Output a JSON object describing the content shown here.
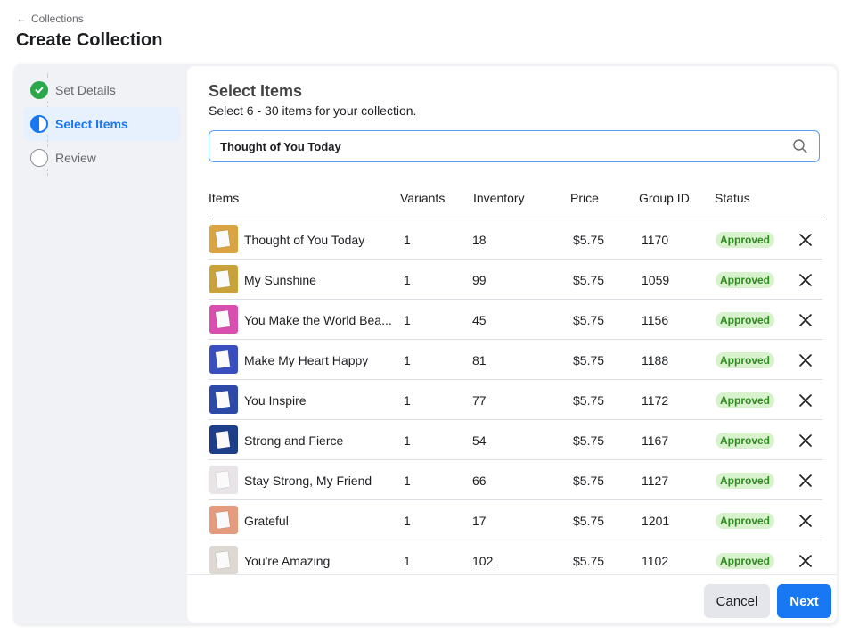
{
  "header": {
    "back_label": "Collections",
    "title": "Create Collection"
  },
  "steps": [
    {
      "label": "Set Details",
      "state": "done"
    },
    {
      "label": "Select Items",
      "state": "active"
    },
    {
      "label": "Review",
      "state": "todo"
    }
  ],
  "panel": {
    "title": "Select Items",
    "subtitle": "Select 6 - 30 items for your collection.",
    "search_value": "Thought of You Today"
  },
  "table": {
    "columns": [
      "Items",
      "Variants",
      "Inventory",
      "Price",
      "Group ID",
      "Status"
    ],
    "rows": [
      {
        "name": "Thought of You Today",
        "variants": "1",
        "inventory": "18",
        "price": "$5.75",
        "group_id": "1170",
        "status": "Approved",
        "thumb": "#d9a441"
      },
      {
        "name": "My Sunshine",
        "variants": "1",
        "inventory": "99",
        "price": "$5.75",
        "group_id": "1059",
        "status": "Approved",
        "thumb": "#c9a23a"
      },
      {
        "name": "You Make the World Bea...",
        "variants": "1",
        "inventory": "45",
        "price": "$5.75",
        "group_id": "1156",
        "status": "Approved",
        "thumb": "#d94fb0"
      },
      {
        "name": "Make My Heart Happy",
        "variants": "1",
        "inventory": "81",
        "price": "$5.75",
        "group_id": "1188",
        "status": "Approved",
        "thumb": "#3a4fbf"
      },
      {
        "name": "You Inspire",
        "variants": "1",
        "inventory": "77",
        "price": "$5.75",
        "group_id": "1172",
        "status": "Approved",
        "thumb": "#2d4aa8"
      },
      {
        "name": "Strong and Fierce",
        "variants": "1",
        "inventory": "54",
        "price": "$5.75",
        "group_id": "1167",
        "status": "Approved",
        "thumb": "#1d3f8a"
      },
      {
        "name": "Stay Strong, My Friend",
        "variants": "1",
        "inventory": "66",
        "price": "$5.75",
        "group_id": "1127",
        "status": "Approved",
        "thumb": "#e9e4e8"
      },
      {
        "name": "Grateful",
        "variants": "1",
        "inventory": "17",
        "price": "$5.75",
        "group_id": "1201",
        "status": "Approved",
        "thumb": "#e59b7e"
      },
      {
        "name": "You're Amazing",
        "variants": "1",
        "inventory": "102",
        "price": "$5.75",
        "group_id": "1102",
        "status": "Approved",
        "thumb": "#ddd8d2"
      }
    ]
  },
  "footer": {
    "cancel_label": "Cancel",
    "next_label": "Next"
  },
  "colors": {
    "accent": "#1877f2",
    "approved_bg": "#d7f2cc",
    "approved_text": "#2e8b1f",
    "done": "#2aa84a"
  },
  "icons": {
    "back": "arrow-left-icon",
    "search": "search-icon",
    "remove": "close-icon",
    "done": "check-circle-icon",
    "active": "half-circle-icon",
    "todo": "empty-circle-icon"
  }
}
